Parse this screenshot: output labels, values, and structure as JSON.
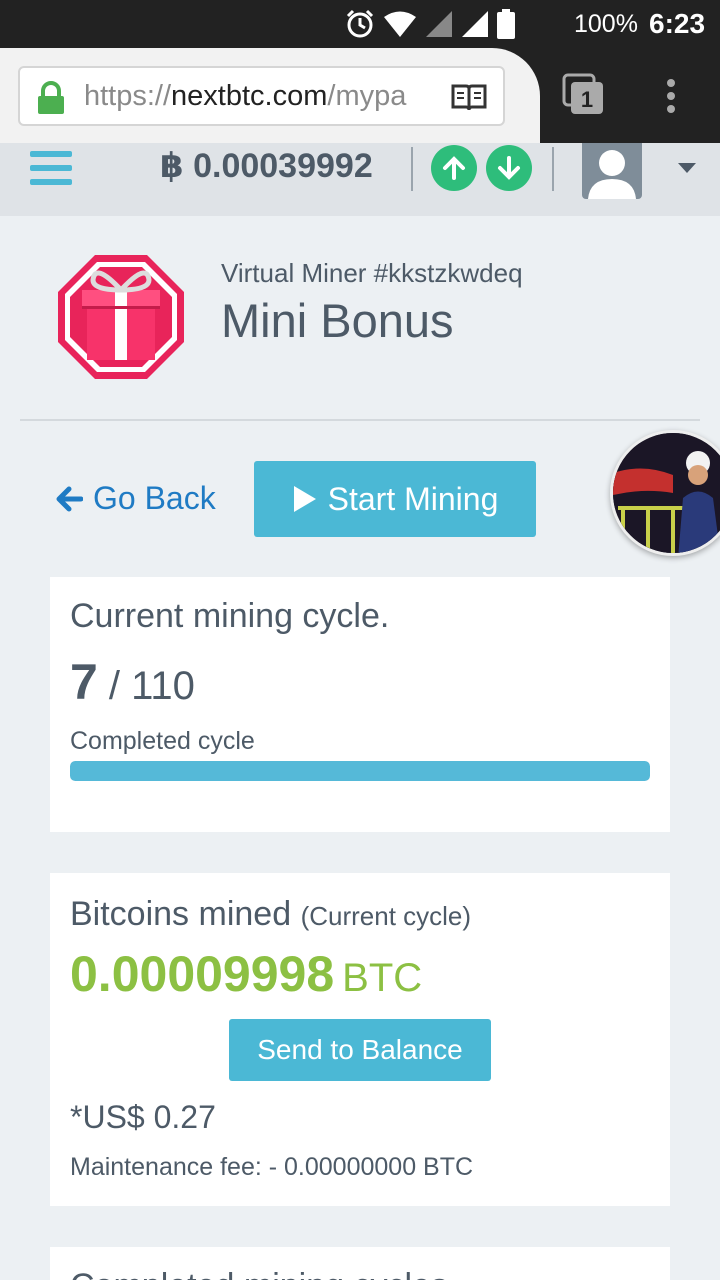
{
  "status_bar": {
    "battery": "100%",
    "time": "6:23"
  },
  "browser": {
    "url_scheme": "https://",
    "url_host": "nextbtc.com",
    "url_path": "/mypa",
    "tab_count": "1"
  },
  "header": {
    "balance": "฿ 0.00039992"
  },
  "miner": {
    "subtitle": "Virtual Miner #kkstzkwdeq",
    "title": "Mini Bonus",
    "go_back_label": "Go Back",
    "start_label": "Start Mining"
  },
  "cycle_card": {
    "title": "Current mining cycle.",
    "current": "7",
    "separator": " / ",
    "total": "110",
    "completed_label": "Completed cycle",
    "progress_percent": 100
  },
  "mined_card": {
    "title": "Bitcoins mined",
    "title_suffix": "(Current cycle)",
    "amount": "0.00009998",
    "unit": "BTC",
    "send_label": "Send to Balance",
    "usd": "*US$ 0.27",
    "fee": "Maintenance fee: - 0.00000000 BTC"
  },
  "next_card": {
    "title": "Completed mining cycles"
  },
  "colors": {
    "accent": "#4bb8d5",
    "green": "#8cc043",
    "arrow_green": "#2ebd7b",
    "link": "#1f7bc4"
  }
}
